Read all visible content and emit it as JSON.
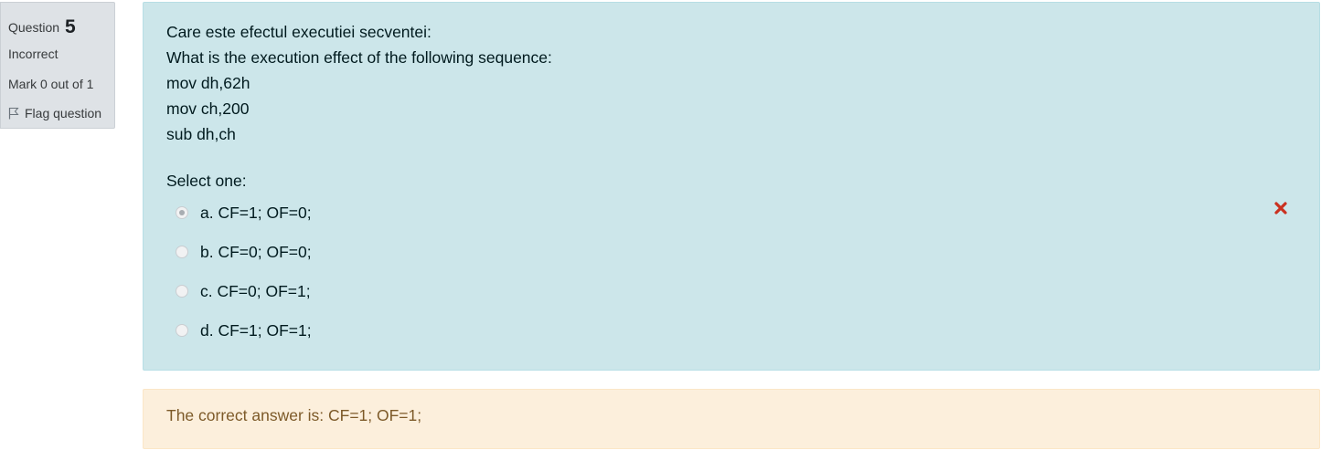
{
  "info": {
    "question_label": "Question",
    "question_number": "5",
    "state": "Incorrect",
    "grade": "Mark 0 out of 1",
    "flag_label": "Flag question"
  },
  "question": {
    "lines": [
      "Care este efectul executiei secventei:",
      "What is the execution effect of the following sequence:",
      "mov dh,62h",
      "mov ch,200",
      "sub dh,ch"
    ],
    "prompt": "Select one:",
    "options": [
      {
        "label": "a. CF=1; OF=0;",
        "checked": true
      },
      {
        "label": "b. CF=0; OF=0;",
        "checked": false
      },
      {
        "label": "c. CF=0; OF=1;",
        "checked": false
      },
      {
        "label": "d. CF=1; OF=1;",
        "checked": false
      }
    ],
    "incorrect_icon": "cross-icon",
    "incorrect_icon_color": "#ca3120"
  },
  "feedback": {
    "right_answer": "The correct answer is: CF=1; OF=1;"
  },
  "colors": {
    "formulation_bg": "#cce6ea",
    "feedback_bg": "#fcefdc",
    "info_bg": "#dee2e6"
  }
}
